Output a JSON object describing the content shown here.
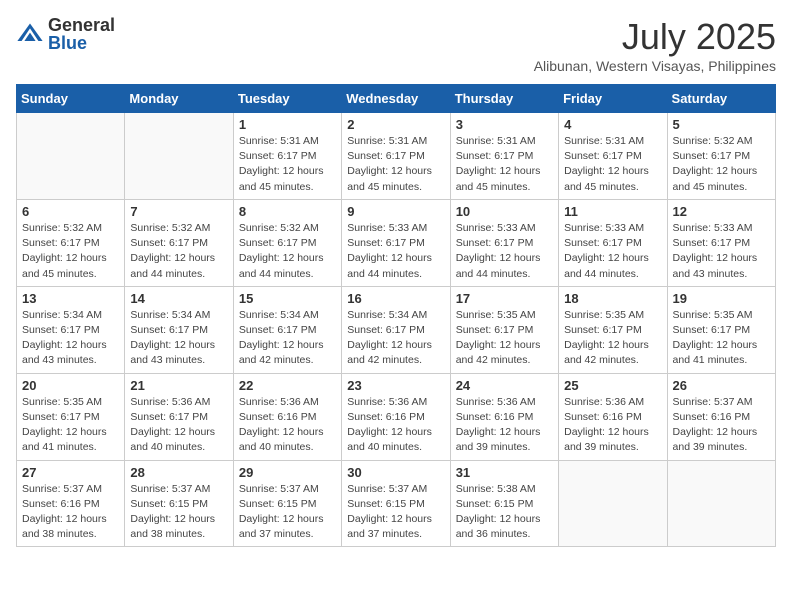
{
  "logo": {
    "general": "General",
    "blue": "Blue"
  },
  "title": {
    "month_year": "July 2025",
    "location": "Alibunan, Western Visayas, Philippines"
  },
  "weekdays": [
    "Sunday",
    "Monday",
    "Tuesday",
    "Wednesday",
    "Thursday",
    "Friday",
    "Saturday"
  ],
  "weeks": [
    [
      {
        "day": "",
        "info": ""
      },
      {
        "day": "",
        "info": ""
      },
      {
        "day": "1",
        "info": "Sunrise: 5:31 AM\nSunset: 6:17 PM\nDaylight: 12 hours and 45 minutes."
      },
      {
        "day": "2",
        "info": "Sunrise: 5:31 AM\nSunset: 6:17 PM\nDaylight: 12 hours and 45 minutes."
      },
      {
        "day": "3",
        "info": "Sunrise: 5:31 AM\nSunset: 6:17 PM\nDaylight: 12 hours and 45 minutes."
      },
      {
        "day": "4",
        "info": "Sunrise: 5:31 AM\nSunset: 6:17 PM\nDaylight: 12 hours and 45 minutes."
      },
      {
        "day": "5",
        "info": "Sunrise: 5:32 AM\nSunset: 6:17 PM\nDaylight: 12 hours and 45 minutes."
      }
    ],
    [
      {
        "day": "6",
        "info": "Sunrise: 5:32 AM\nSunset: 6:17 PM\nDaylight: 12 hours and 45 minutes."
      },
      {
        "day": "7",
        "info": "Sunrise: 5:32 AM\nSunset: 6:17 PM\nDaylight: 12 hours and 44 minutes."
      },
      {
        "day": "8",
        "info": "Sunrise: 5:32 AM\nSunset: 6:17 PM\nDaylight: 12 hours and 44 minutes."
      },
      {
        "day": "9",
        "info": "Sunrise: 5:33 AM\nSunset: 6:17 PM\nDaylight: 12 hours and 44 minutes."
      },
      {
        "day": "10",
        "info": "Sunrise: 5:33 AM\nSunset: 6:17 PM\nDaylight: 12 hours and 44 minutes."
      },
      {
        "day": "11",
        "info": "Sunrise: 5:33 AM\nSunset: 6:17 PM\nDaylight: 12 hours and 44 minutes."
      },
      {
        "day": "12",
        "info": "Sunrise: 5:33 AM\nSunset: 6:17 PM\nDaylight: 12 hours and 43 minutes."
      }
    ],
    [
      {
        "day": "13",
        "info": "Sunrise: 5:34 AM\nSunset: 6:17 PM\nDaylight: 12 hours and 43 minutes."
      },
      {
        "day": "14",
        "info": "Sunrise: 5:34 AM\nSunset: 6:17 PM\nDaylight: 12 hours and 43 minutes."
      },
      {
        "day": "15",
        "info": "Sunrise: 5:34 AM\nSunset: 6:17 PM\nDaylight: 12 hours and 42 minutes."
      },
      {
        "day": "16",
        "info": "Sunrise: 5:34 AM\nSunset: 6:17 PM\nDaylight: 12 hours and 42 minutes."
      },
      {
        "day": "17",
        "info": "Sunrise: 5:35 AM\nSunset: 6:17 PM\nDaylight: 12 hours and 42 minutes."
      },
      {
        "day": "18",
        "info": "Sunrise: 5:35 AM\nSunset: 6:17 PM\nDaylight: 12 hours and 42 minutes."
      },
      {
        "day": "19",
        "info": "Sunrise: 5:35 AM\nSunset: 6:17 PM\nDaylight: 12 hours and 41 minutes."
      }
    ],
    [
      {
        "day": "20",
        "info": "Sunrise: 5:35 AM\nSunset: 6:17 PM\nDaylight: 12 hours and 41 minutes."
      },
      {
        "day": "21",
        "info": "Sunrise: 5:36 AM\nSunset: 6:17 PM\nDaylight: 12 hours and 40 minutes."
      },
      {
        "day": "22",
        "info": "Sunrise: 5:36 AM\nSunset: 6:16 PM\nDaylight: 12 hours and 40 minutes."
      },
      {
        "day": "23",
        "info": "Sunrise: 5:36 AM\nSunset: 6:16 PM\nDaylight: 12 hours and 40 minutes."
      },
      {
        "day": "24",
        "info": "Sunrise: 5:36 AM\nSunset: 6:16 PM\nDaylight: 12 hours and 39 minutes."
      },
      {
        "day": "25",
        "info": "Sunrise: 5:36 AM\nSunset: 6:16 PM\nDaylight: 12 hours and 39 minutes."
      },
      {
        "day": "26",
        "info": "Sunrise: 5:37 AM\nSunset: 6:16 PM\nDaylight: 12 hours and 39 minutes."
      }
    ],
    [
      {
        "day": "27",
        "info": "Sunrise: 5:37 AM\nSunset: 6:16 PM\nDaylight: 12 hours and 38 minutes."
      },
      {
        "day": "28",
        "info": "Sunrise: 5:37 AM\nSunset: 6:15 PM\nDaylight: 12 hours and 38 minutes."
      },
      {
        "day": "29",
        "info": "Sunrise: 5:37 AM\nSunset: 6:15 PM\nDaylight: 12 hours and 37 minutes."
      },
      {
        "day": "30",
        "info": "Sunrise: 5:37 AM\nSunset: 6:15 PM\nDaylight: 12 hours and 37 minutes."
      },
      {
        "day": "31",
        "info": "Sunrise: 5:38 AM\nSunset: 6:15 PM\nDaylight: 12 hours and 36 minutes."
      },
      {
        "day": "",
        "info": ""
      },
      {
        "day": "",
        "info": ""
      }
    ]
  ]
}
